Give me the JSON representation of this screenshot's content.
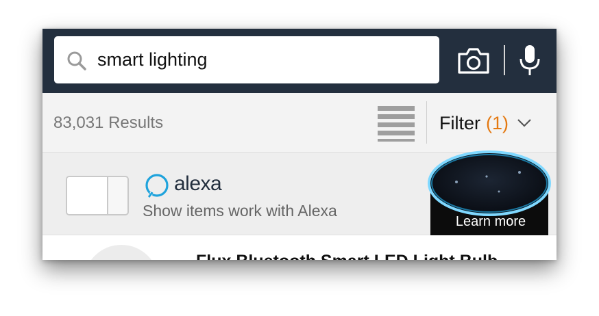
{
  "search": {
    "query": "smart lighting"
  },
  "results": {
    "count_label": "83,031 Results"
  },
  "filter": {
    "label": "Filter",
    "count": "(1)"
  },
  "alexa_banner": {
    "wordmark": "alexa",
    "subtitle": "Show items work with Alexa",
    "learn_more": "Learn more"
  },
  "product": {
    "title": "Flux Bluetooth Smart LED Light Bulb"
  },
  "icons": {
    "search": "search-icon",
    "camera": "camera-icon",
    "microphone": "microphone-icon",
    "list_view": "list-view-icon",
    "chevron": "chevron-down-icon",
    "alexa": "alexa-logo-icon"
  },
  "colors": {
    "header_bg": "#232f3e",
    "filter_count": "#e47911",
    "alexa_blue": "#1fa3dc"
  }
}
